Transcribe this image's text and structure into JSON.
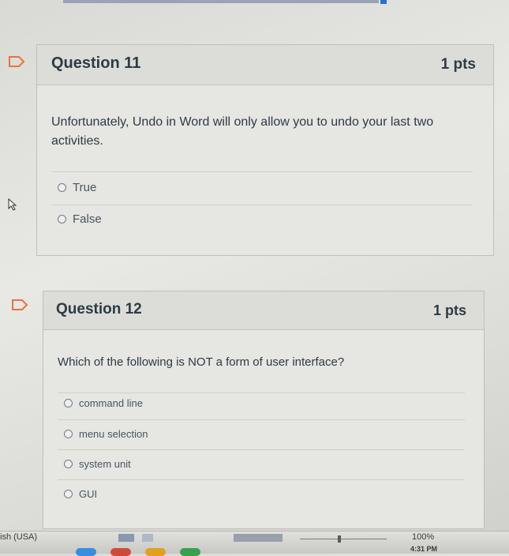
{
  "questions": [
    {
      "title": "Question 11",
      "points": "1 pts",
      "text": "Unfortunately, Undo in Word will only allow you to undo your last two activities.",
      "answers": [
        "True",
        "False"
      ]
    },
    {
      "title": "Question 12",
      "points": "1 pts",
      "text": "Which of the following is NOT a form of user interface?",
      "answers": [
        "command line",
        "menu selection",
        "system unit",
        "GUI"
      ]
    }
  ],
  "statusbar": {
    "language": "ish (USA)",
    "zoom": "100%",
    "clock": "4:31 PM"
  },
  "colors": {
    "flag_orange": "#e8733a",
    "text": "#2d3b45"
  }
}
